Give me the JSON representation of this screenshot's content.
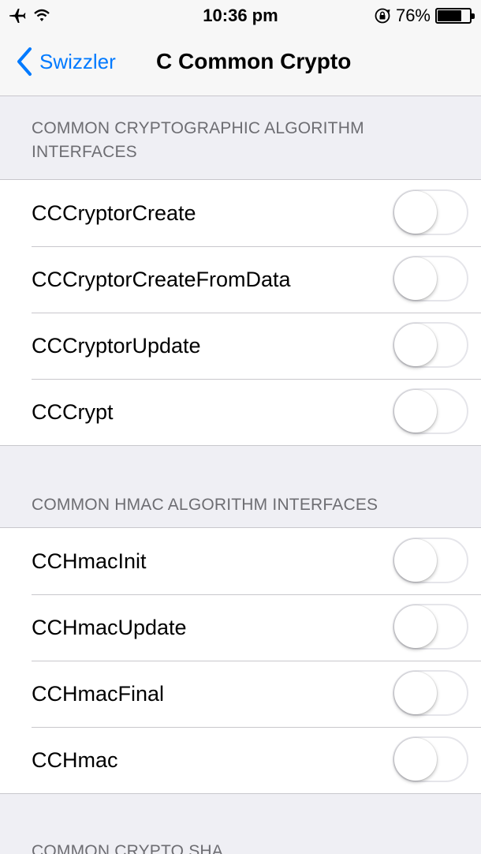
{
  "status_bar": {
    "time": "10:36 pm",
    "battery_percent": "76%",
    "battery_level": 0.76,
    "icons": [
      "airplane-icon",
      "wifi-icon",
      "rotation-lock-icon",
      "battery-icon"
    ]
  },
  "nav": {
    "back_label": "Swizzler",
    "title": "C Common Crypto",
    "accent_color": "#007aff"
  },
  "sections": [
    {
      "header": "COMMON CRYPTOGRAPHIC ALGORITHM INTERFACES",
      "rows": [
        {
          "label": "CCCryptorCreate",
          "on": false
        },
        {
          "label": "CCCryptorCreateFromData",
          "on": false
        },
        {
          "label": "CCCryptorUpdate",
          "on": false
        },
        {
          "label": "CCCrypt",
          "on": false
        }
      ]
    },
    {
      "header": "COMMON HMAC ALGORITHM INTERFACES",
      "rows": [
        {
          "label": "CCHmacInit",
          "on": false
        },
        {
          "label": "CCHmacUpdate",
          "on": false
        },
        {
          "label": "CCHmacFinal",
          "on": false
        },
        {
          "label": "CCHmac",
          "on": false
        }
      ]
    },
    {
      "header": "COMMON CRYPTO SHA",
      "rows": []
    }
  ]
}
